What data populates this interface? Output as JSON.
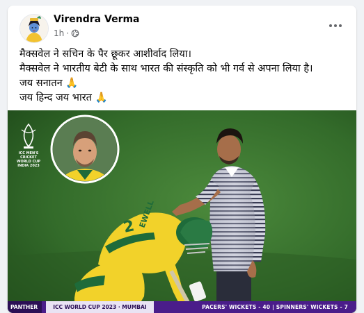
{
  "post": {
    "author": "Virendra Verma",
    "time": "1h",
    "dot": "·",
    "lines": [
      "मैक्सवेल ने सचिन के पैर छूकर आशीर्वाद लिया।",
      "मैक्सवेल ने भारतीय बेटी के साथ भारत की संस्कृति को भी गर्व से अपना लिया है।",
      "जय सनातन 🙏",
      "जय हिन्द जय भारत 🙏"
    ]
  },
  "photo": {
    "logo_lines": [
      "ICC MEN'S",
      "CRICKET",
      "WORLD CUP",
      "INDIA 2023"
    ],
    "jersey_text": "EWELL",
    "jersey_number": "2",
    "ticker": {
      "brand": "PANTHER",
      "league": "ICC WORLD CUP 2023 · MUMBAI",
      "stats": "PACERS' WICKETS - 40 | SPINNERS' WICKETS - 7"
    }
  },
  "colors": {
    "field_dark": "#1f4a1a",
    "field_light": "#4c8a3c",
    "aus_yellow": "#f2d22a",
    "ticker_purple": "#4a1d8a"
  }
}
